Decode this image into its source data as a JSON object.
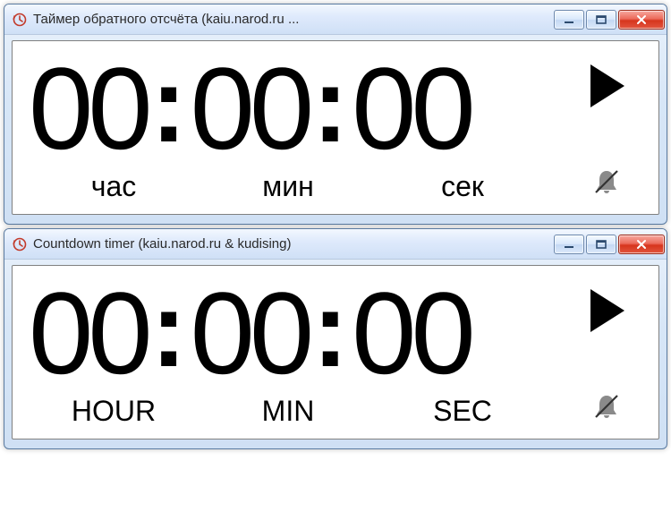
{
  "windows": [
    {
      "title": "Таймер обратного отсчёта (kaiu.narod.ru ...",
      "time": {
        "hours": "00",
        "minutes": "00",
        "seconds": "00"
      },
      "labels": {
        "hour": "час",
        "min": "мин",
        "sec": "сек"
      }
    },
    {
      "title": "Countdown timer (kaiu.narod.ru & kudising)",
      "time": {
        "hours": "00",
        "minutes": "00",
        "seconds": "00"
      },
      "labels": {
        "hour": "HOUR",
        "min": "MIN",
        "sec": "SEC"
      }
    }
  ],
  "separator": ":",
  "icons": {
    "app": "clock-history-icon",
    "play": "play-icon",
    "bell": "bell-muted-icon"
  }
}
